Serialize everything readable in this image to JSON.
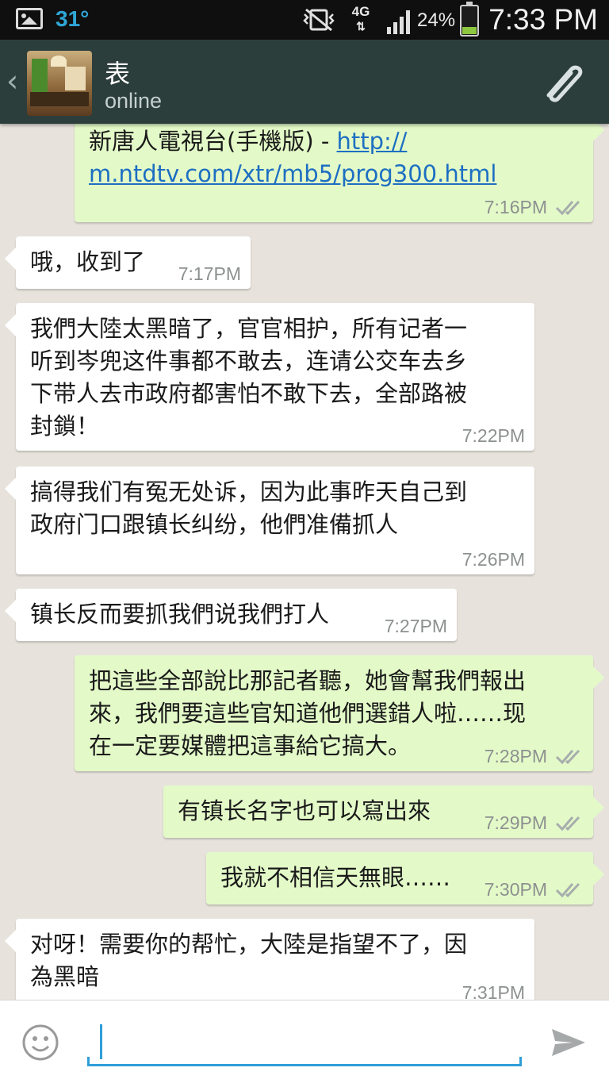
{
  "status_bar": {
    "temperature": "31°",
    "network": "4G",
    "battery_percent": "24%",
    "battery_level": 0.24,
    "time": "7:33 PM"
  },
  "header": {
    "back_icon": "chevron-left-icon",
    "contact_name": "表",
    "contact_status": "online",
    "attach_icon": "paperclip-icon"
  },
  "messages": [
    {
      "direction": "out",
      "text": "新唐人電視台(手機版) - ",
      "link": "http://\nm.ntdtv.com/xtr/mb5/prog300.html",
      "time": "7:16PM",
      "ticks": "double"
    },
    {
      "direction": "in",
      "text": "哦，收到了",
      "time": "7:17PM"
    },
    {
      "direction": "in",
      "text": "我們大陸太黑暗了，官官相护，所有记者一\n听到岑兜这件事都不敢去，连请公交车去乡\n下带人去市政府都害怕不敢下去，全部路被\n封鎖！",
      "time": "7:22PM"
    },
    {
      "direction": "in",
      "text": "搞得我们有冤无处诉，因为此事昨天自己到\n政府门口跟镇长纠纷，他們准備抓人",
      "time": "7:26PM"
    },
    {
      "direction": "in",
      "text": "镇长反而要抓我們说我們打人",
      "time": "7:27PM"
    },
    {
      "direction": "out",
      "text": "把這些全部說比那記者聽，她會幫我們報出\n來，我們要這些官知道他們選錯人啦……现\n在一定要媒體把這事給它搞大。",
      "time": "7:28PM",
      "ticks": "double"
    },
    {
      "direction": "out",
      "text": "有镇长名字也可以寫出來",
      "time": "7:29PM",
      "ticks": "double"
    },
    {
      "direction": "out",
      "text": "我就不相信天無眼……",
      "time": "7:30PM",
      "ticks": "double"
    },
    {
      "direction": "in",
      "text": "对呀！需要你的帮忙，大陸是指望不了，因\n為黑暗",
      "time": "7:31PM"
    }
  ],
  "input_bar": {
    "emoji_icon": "smiley-icon",
    "value": "",
    "send_icon": "send-icon"
  },
  "colors": {
    "header_bg": "#2c3e3c",
    "chat_bg": "#e7e3dc",
    "bubble_out": "#e3fac8",
    "bubble_in": "#ffffff",
    "link": "#1d6fc2",
    "accent": "#2f9ed8"
  }
}
